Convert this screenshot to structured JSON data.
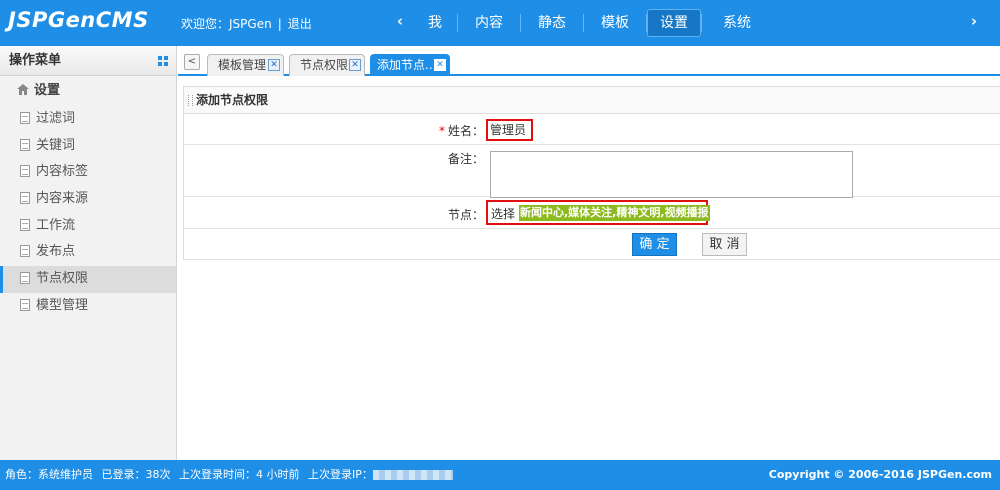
{
  "header": {
    "logo": "JSPGenCMS",
    "welcome": "欢迎您：JSPGen",
    "logout": "退出",
    "nav": [
      {
        "label": "我",
        "active": false
      },
      {
        "label": "内容",
        "active": false
      },
      {
        "label": "静态",
        "active": false
      },
      {
        "label": "模板",
        "active": false
      },
      {
        "label": "设置",
        "active": true
      },
      {
        "label": "系统",
        "active": false
      }
    ],
    "accent_color": "#1e8ee6"
  },
  "sidebar": {
    "title": "操作菜单",
    "section": "设置",
    "items": [
      {
        "label": "过滤词",
        "active": false
      },
      {
        "label": "关键词",
        "active": false
      },
      {
        "label": "内容标签",
        "active": false
      },
      {
        "label": "内容来源",
        "active": false
      },
      {
        "label": "工作流",
        "active": false
      },
      {
        "label": "发布点",
        "active": false
      },
      {
        "label": "节点权限",
        "active": true
      },
      {
        "label": "模型管理",
        "active": false
      }
    ]
  },
  "tabs": [
    {
      "label": "模板管理",
      "active": false
    },
    {
      "label": "节点权限",
      "active": false
    },
    {
      "label": "添加节点..",
      "active": true
    }
  ],
  "form": {
    "title": "添加节点权限",
    "name_label": "姓名：",
    "name_required_mark": "*",
    "name_value": "管理员",
    "remark_label": "备注：",
    "remark_value": "",
    "node_label": "节点：",
    "node_select": "选择",
    "node_value": "新闻中心,媒体关注,精神文明,视频播报",
    "ok_label": "确 定",
    "cancel_label": "取 消"
  },
  "footer": {
    "role": "角色：系统维护员",
    "logins": "已登录：38次",
    "last_time": "上次登录时间：4 小时前",
    "last_ip": "上次登录IP：",
    "copyright": "Copyright © 2006-2016 JSPGen.com"
  }
}
